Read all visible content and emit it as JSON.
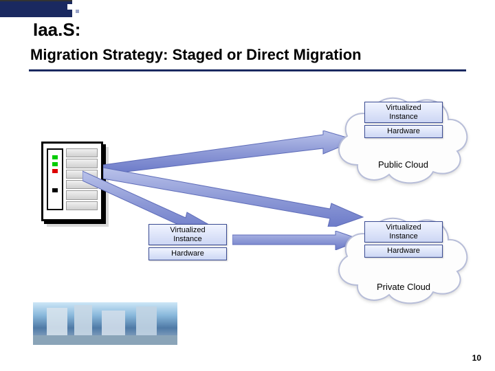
{
  "title1": "Iaa.S:",
  "title2": "Migration Strategy: Staged or Direct Migration",
  "stacks": {
    "public": {
      "vi": "Virtualized\nInstance",
      "hw": "Hardware"
    },
    "internal": {
      "vi": "Virtualized\nInstance",
      "hw": "Hardware"
    },
    "private": {
      "vi": "Virtualized\nInstance",
      "hw": "Hardware"
    }
  },
  "labels": {
    "public": "Public Cloud",
    "private": "Private Cloud"
  },
  "page": "10"
}
